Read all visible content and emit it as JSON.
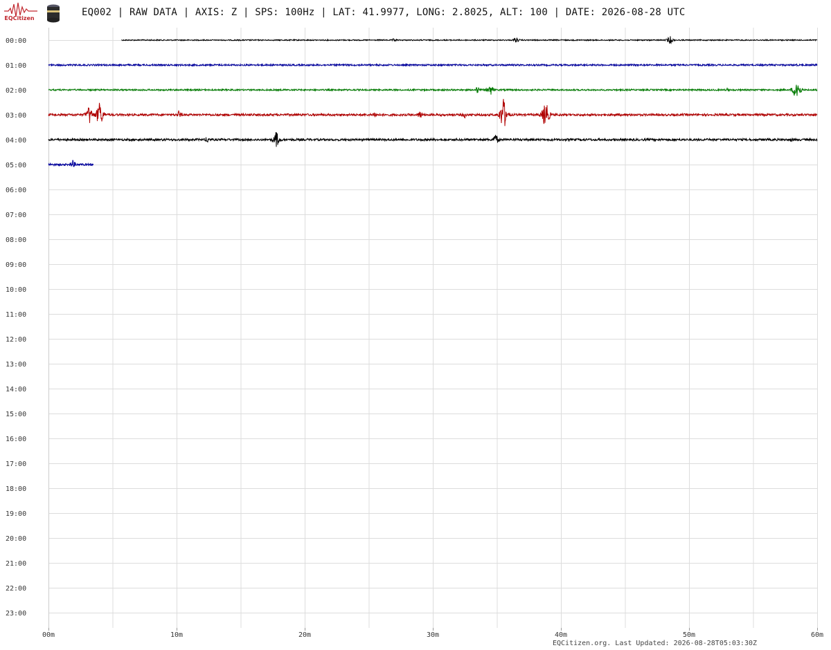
{
  "header": {
    "logo_text": "EQCitizen",
    "title": "EQ002 | RAW DATA | AXIS: Z | SPS: 100Hz | LAT: 41.9977, LONG: 2.8025, ALT: 100 | DATE: 2026-08-28 UTC"
  },
  "icons": {
    "logo": "seismogram-logo-icon",
    "sensor": "sensor-device-icon"
  },
  "footer": {
    "text": "EQCitizen.org. Last Updated: 2026-08-28T05:03:30Z"
  },
  "chart_data": {
    "type": "line",
    "title": "EQ002 | RAW DATA | AXIS: Z | SPS: 100Hz | LAT: 41.9977, LONG: 2.8025, ALT: 100 | DATE: 2026-08-28 UTC",
    "xlabel": "",
    "ylabel": "",
    "grid": true,
    "xlim": [
      0,
      60
    ],
    "x_ticks": [
      "00m",
      "10m",
      "20m",
      "30m",
      "40m",
      "50m",
      "60m"
    ],
    "x_tick_values": [
      0,
      10,
      20,
      30,
      40,
      50,
      60
    ],
    "minor_grid_step_minutes": 5,
    "y_ticks": [
      "00:00",
      "01:00",
      "02:00",
      "03:00",
      "04:00",
      "05:00",
      "06:00",
      "07:00",
      "08:00",
      "09:00",
      "10:00",
      "11:00",
      "12:00",
      "13:00",
      "14:00",
      "15:00",
      "16:00",
      "17:00",
      "18:00",
      "19:00",
      "20:00",
      "21:00",
      "22:00",
      "23:00"
    ],
    "line_colors": [
      "#000000",
      "#00009c",
      "#007a00",
      "#b00000"
    ],
    "series": [
      {
        "hour": "00:00",
        "color": "#000000",
        "start_minute": 5.7,
        "end_minute": 60,
        "noise": 0.8,
        "events": [
          [
            0.2,
            4
          ],
          [
            27,
            3
          ],
          [
            36.5,
            5
          ],
          [
            48.5,
            7
          ]
        ]
      },
      {
        "hour": "01:00",
        "color": "#00009c",
        "start_minute": 0,
        "end_minute": 60,
        "noise": 1.2,
        "events": [
          [
            58.4,
            2
          ]
        ]
      },
      {
        "hour": "02:00",
        "color": "#007a00",
        "start_minute": 0,
        "end_minute": 60,
        "noise": 1.1,
        "events": [
          [
            33.5,
            6
          ],
          [
            34.5,
            9
          ],
          [
            53,
            3
          ],
          [
            58.4,
            22
          ]
        ]
      },
      {
        "hour": "03:00",
        "color": "#b00000",
        "start_minute": 0,
        "end_minute": 60,
        "noise": 1.6,
        "events": [
          [
            3.2,
            16
          ],
          [
            4.0,
            24
          ],
          [
            10.2,
            7
          ],
          [
            25.5,
            6
          ],
          [
            29,
            7
          ],
          [
            32.5,
            5
          ],
          [
            35.5,
            30
          ],
          [
            38.8,
            26
          ]
        ]
      },
      {
        "hour": "04:00",
        "color": "#000000",
        "start_minute": 0,
        "end_minute": 60,
        "noise": 1.6,
        "events": [
          [
            12.4,
            6
          ],
          [
            17.8,
            14
          ],
          [
            34.9,
            10
          ],
          [
            58,
            4
          ]
        ]
      },
      {
        "hour": "05:00",
        "color": "#00009c",
        "start_minute": 0,
        "end_minute": 3.5,
        "noise": 1.5,
        "events": [
          [
            1.9,
            7
          ]
        ]
      }
    ]
  }
}
